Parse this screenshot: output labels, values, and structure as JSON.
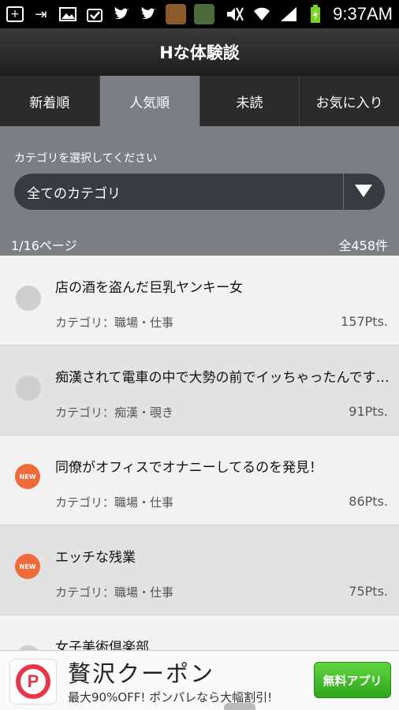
{
  "status_bar": {
    "time": "9:37AM",
    "left_icons": [
      "add-icon",
      "forward-icon",
      "image-icon",
      "check-icon",
      "twitter-icon",
      "twitter-icon",
      "app-icon",
      "app-icon"
    ],
    "right_icons": [
      "mute-icon",
      "wifi-icon",
      "signal-icon",
      "battery-icon"
    ]
  },
  "header": {
    "title": "Hな体験談"
  },
  "tabs": [
    {
      "label": "新着順",
      "active": false
    },
    {
      "label": "人気順",
      "active": true
    },
    {
      "label": "未読",
      "active": false
    },
    {
      "label": "お気に入り",
      "active": false
    }
  ],
  "category": {
    "prompt": "カテゴリを選択してください",
    "selected": "全てのカテゴリ"
  },
  "pagination": {
    "page": "1/16ページ",
    "total": "全458件"
  },
  "list": [
    {
      "title": "店の酒を盗んだ巨乳ヤンキー女",
      "category": "カテゴリ：職場・仕事",
      "points": "157Pts.",
      "new": false
    },
    {
      "title": "痴漢されて電車の中で大勢の前でイッちゃったんです…",
      "category": "カテゴリ：痴漢・覗き",
      "points": "91Pts.",
      "new": false
    },
    {
      "title": "同僚がオフィスでオナニーしてるのを発見！",
      "category": "カテゴリ：職場・仕事",
      "points": "86Pts.",
      "new": true
    },
    {
      "title": "エッチな残業",
      "category": "カテゴリ：職場・仕事",
      "points": "75Pts.",
      "new": true
    },
    {
      "title": "女子美術倶楽部",
      "category": "",
      "points": "",
      "new": false
    }
  ],
  "new_badge": "NEW",
  "ad": {
    "title": "贅沢クーポン",
    "subtitle": "最大90%OFF! ポンパレなら大幅割引!",
    "button": "無料アプリ",
    "logo_letter": "P"
  },
  "colors": {
    "tab_active": "#7b7f83",
    "new_badge": "#ef6b3a",
    "ad_button": "#3bb522"
  }
}
